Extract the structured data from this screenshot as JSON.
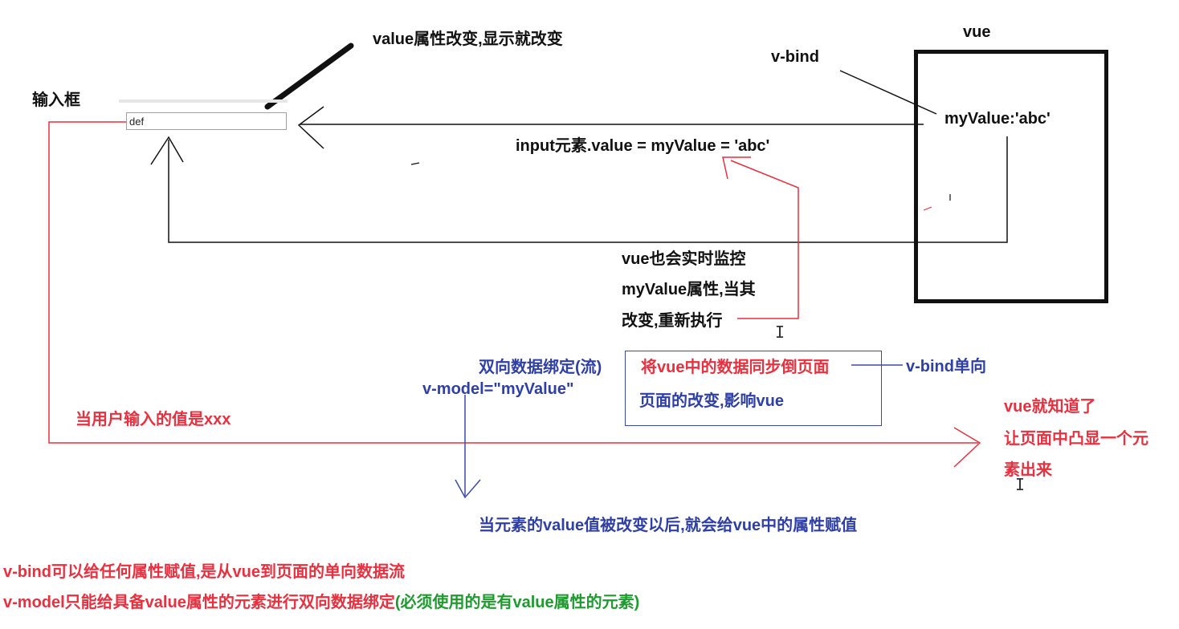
{
  "input": {
    "label": "输入框",
    "value": "def"
  },
  "labels": {
    "value_changes": "value属性改变,显示就改变",
    "vue_title": "vue",
    "v_bind": "v-bind",
    "my_value": "myValue:'abc'",
    "assignment": "input元素.value = myValue = 'abc'",
    "monitor_line1": "vue也会实时监控",
    "monitor_line2": "myValue属性,当其",
    "monitor_line3": "改变,重新执行",
    "two_way_title": "双向数据绑定(流)",
    "v_model": "v-model=\"myValue\"",
    "sync_to_page": "将vue中的数据同步倒页面",
    "page_affects_vue": "页面的改变,影响vue",
    "v_bind_oneway": "v-bind单向",
    "user_input": "当用户输入的值是xxx",
    "vue_knows_1": "vue就知道了",
    "vue_knows_2": "让页面中凸显一个元",
    "vue_knows_3": "素出来",
    "assign_on_change": "当元素的value值被改变以后,就会给vue中的属性赋值"
  },
  "notes": {
    "v_bind_note": "v-bind可以给任何属性赋值,是从vue到页面的单向数据流",
    "v_model_note_main": "v-model只能给具备value属性的元素进行双向数据绑定",
    "v_model_note_paren": "(必须使用的是有value属性的元素)"
  },
  "colors": {
    "black": "#111111",
    "red": "#e8303f",
    "blue": "#2e3fa6",
    "green": "#1e9a2e"
  }
}
